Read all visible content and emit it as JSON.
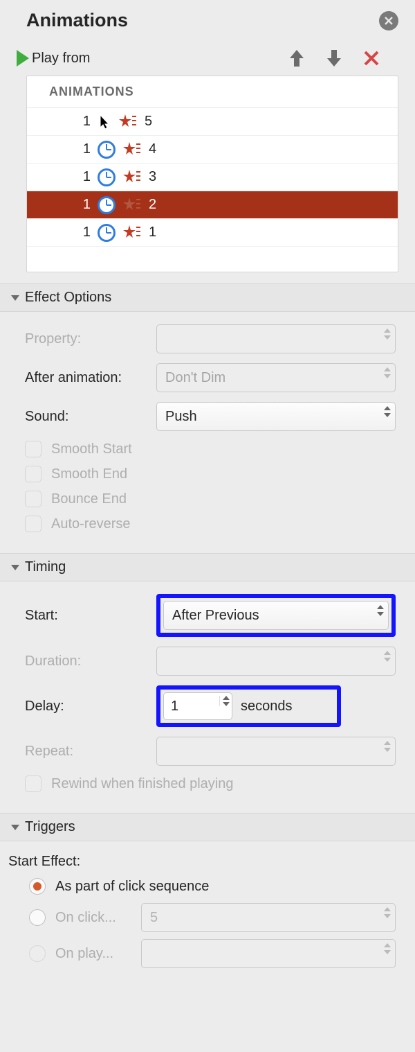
{
  "panel": {
    "title": "Animations",
    "play_label": "Play from",
    "list_header": "ANIMATIONS"
  },
  "anim_list": [
    {
      "num": "1",
      "trigger": "click",
      "label": "5"
    },
    {
      "num": "1",
      "trigger": "clock",
      "label": "4"
    },
    {
      "num": "1",
      "trigger": "clock",
      "label": "3"
    },
    {
      "num": "1",
      "trigger": "clock",
      "label": "2",
      "selected": true
    },
    {
      "num": "1",
      "trigger": "clock",
      "label": "1"
    }
  ],
  "sections": {
    "effect": "Effect Options",
    "timing": "Timing",
    "triggers": "Triggers"
  },
  "effect": {
    "property_label": "Property:",
    "after_anim_label": "After animation:",
    "after_anim_value": "Don't Dim",
    "sound_label": "Sound:",
    "sound_value": "Push",
    "smooth_start": "Smooth Start",
    "smooth_end": "Smooth End",
    "bounce_end": "Bounce End",
    "auto_reverse": "Auto-reverse"
  },
  "timing": {
    "start_label": "Start:",
    "start_value": "After Previous",
    "duration_label": "Duration:",
    "delay_label": "Delay:",
    "delay_value": "1",
    "delay_unit": "seconds",
    "repeat_label": "Repeat:",
    "rewind_label": "Rewind when finished playing"
  },
  "triggers": {
    "start_effect_label": "Start Effect:",
    "opt_seq": "As part of click sequence",
    "opt_click": "On click...",
    "opt_click_value": "5",
    "opt_play": "On play..."
  }
}
